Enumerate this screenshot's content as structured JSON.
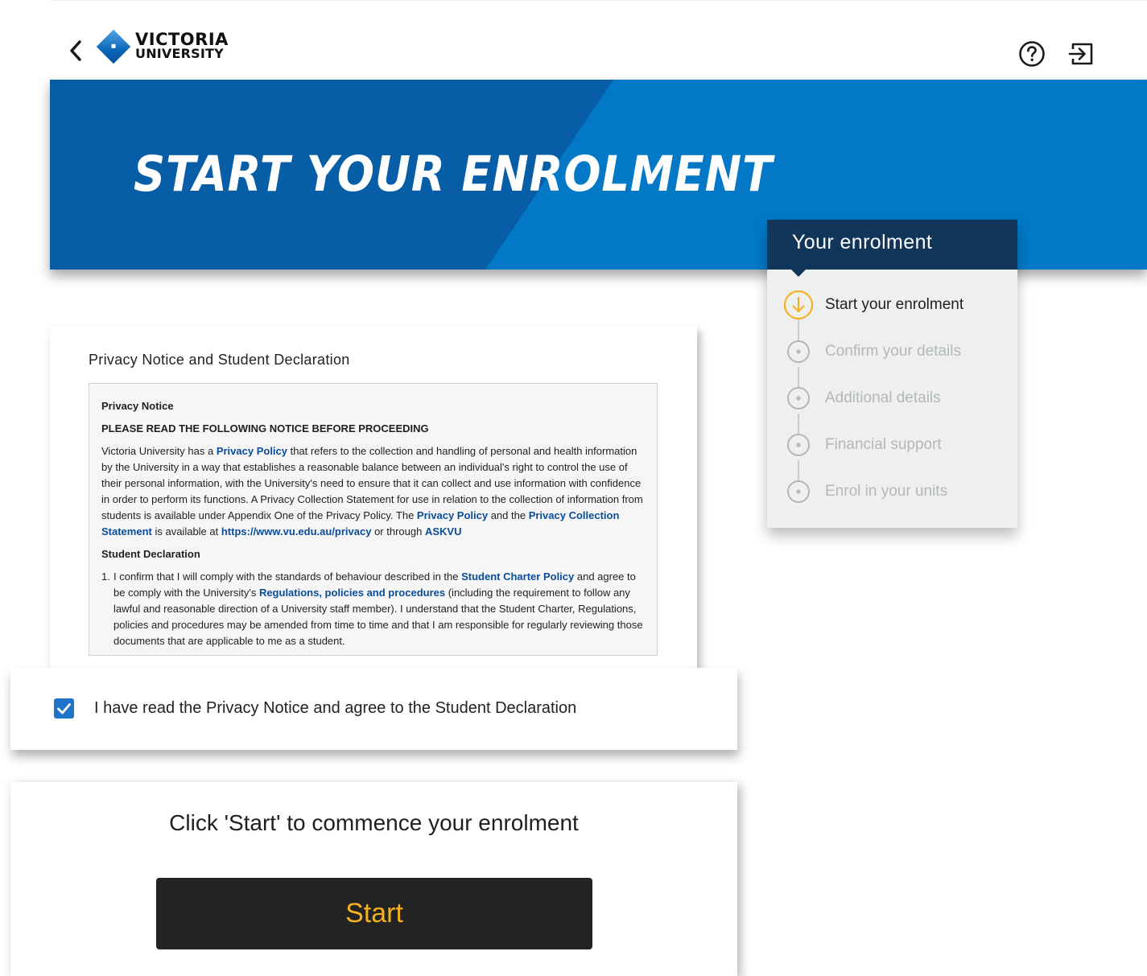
{
  "header": {
    "logo": {
      "line1": "VICTORIA",
      "line2": "UNIVERSITY"
    }
  },
  "banner": {
    "title": "START YOUR ENROLMENT"
  },
  "enrolment_panel": {
    "title": "Your enrolment",
    "steps": [
      {
        "label": "Start your enrolment",
        "state": "current"
      },
      {
        "label": "Confirm your details",
        "state": "pending"
      },
      {
        "label": "Additional details",
        "state": "pending"
      },
      {
        "label": "Financial support",
        "state": "pending"
      },
      {
        "label": "Enrol in your units",
        "state": "pending"
      }
    ]
  },
  "privacy": {
    "title": "Privacy Notice and Student Declaration",
    "notice_heading": "Privacy Notice",
    "notice_subheading": "PLEASE READ THE FOLLOWING NOTICE BEFORE PROCEEDING",
    "para": {
      "t1": "Victoria University has a ",
      "l1": "Privacy Policy",
      "t2": " that refers to the collection and handling of personal and health information by the University in a way that establishes a reasonable balance between an individual's right to control the use of their personal information, with the University's need to ensure that it can collect and use information with confidence in order to perform its functions. A Privacy Collection Statement for use in relation to the collection of information from students is available under Appendix One of the Privacy Policy. The ",
      "l2": "Privacy Policy",
      "t3": " and the ",
      "l3": "Privacy Collection Statement",
      "t4": " is available at ",
      "l4": "https://www.vu.edu.au/privacy",
      "t5": " or through ",
      "l5": "ASKVU"
    },
    "declaration_heading": "Student Declaration",
    "declaration_item": {
      "num": "1.",
      "t1": "I confirm that I will comply with the standards of behaviour described in the ",
      "l1": "Student Charter Policy",
      "t2": " and agree to be comply with the University's ",
      "l2": "Regulations, policies and procedures",
      "t3": " (including the requirement to follow any lawful and reasonable direction of a University staff member). I understand that the Student Charter, Regulations, policies and procedures may be amended from time to time and that I am responsible for regularly reviewing those documents that are applicable to me as a student."
    }
  },
  "agreement": {
    "checked": true,
    "label": "I have read the Privacy Notice and agree to the Student Declaration"
  },
  "start": {
    "instruction": "Click 'Start' to commence your enrolment",
    "button_label": "Start"
  },
  "colors": {
    "banner_dark": "#075ea6",
    "banner_light": "#0278c6",
    "panel_header": "#12365a",
    "link": "#0a4c9a",
    "active_step": "#f4b223",
    "checkbox": "#1f73c9",
    "start_button_bg": "#232323",
    "start_button_text": "#f4b223"
  },
  "icons": {
    "back": "chevron-left-icon",
    "help": "question-circle-icon",
    "logout": "logout-icon",
    "current_step": "arrow-down-circle-icon",
    "pending_step": "dot-circle-icon",
    "checkbox": "checkmark-icon"
  }
}
